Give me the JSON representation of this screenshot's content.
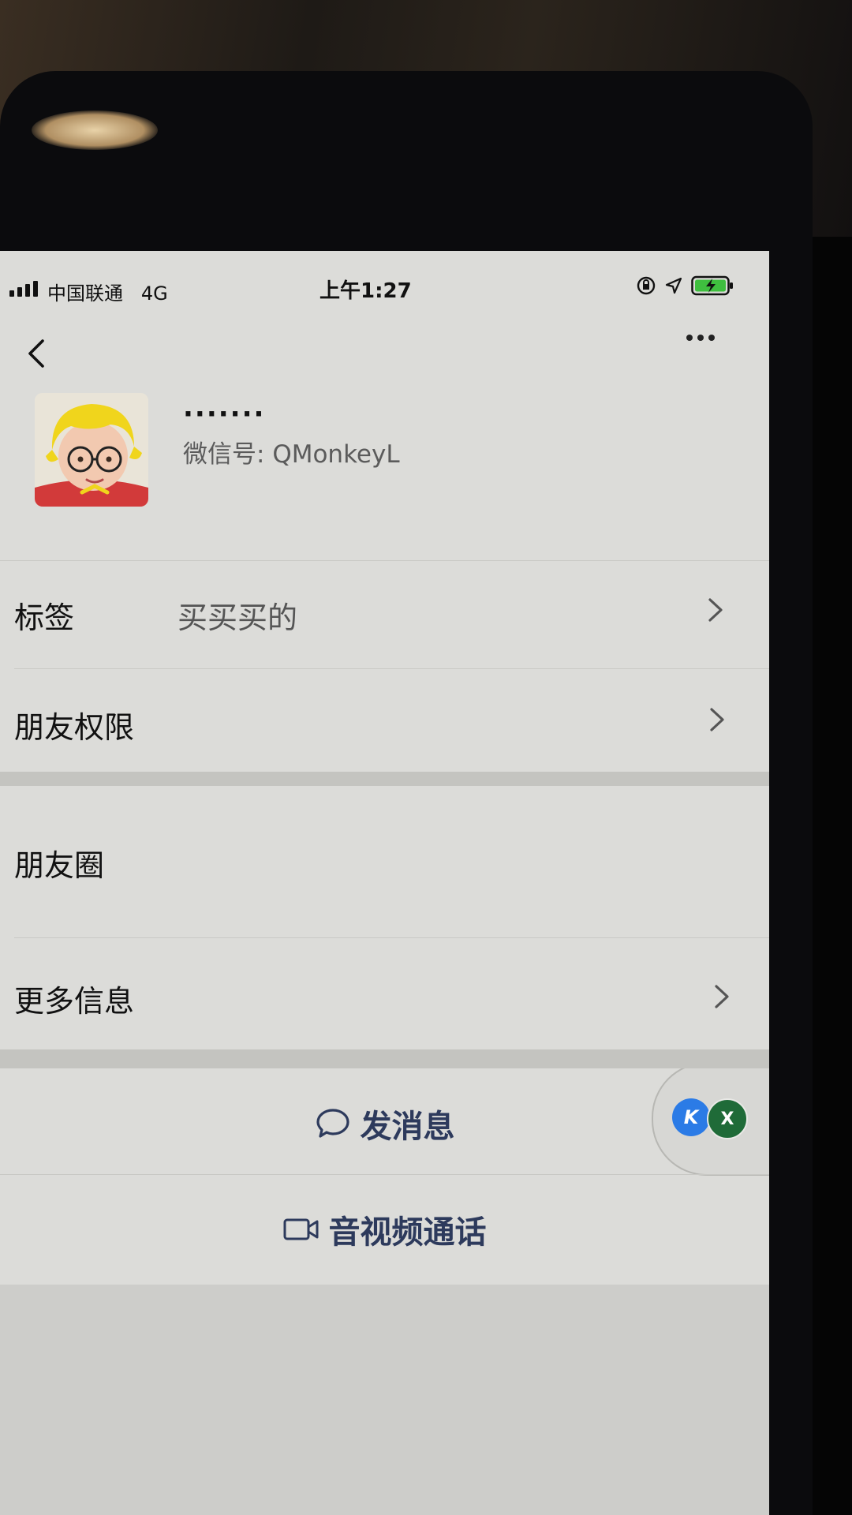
{
  "status_bar": {
    "carrier": "中国联通",
    "network": "4G",
    "time": "上午1:27"
  },
  "profile": {
    "nickname": "·······",
    "wechat_id_label": "微信号:",
    "wechat_id": "QMonkeyL"
  },
  "rows": [
    {
      "label": "标签",
      "value": "买买买的",
      "has_chevron": true
    },
    {
      "label": "朋友权限",
      "value": "",
      "has_chevron": true
    },
    {
      "label": "朋友圈",
      "value": "",
      "badges": [
        "K",
        "X"
      ]
    },
    {
      "label": "更多信息",
      "value": "",
      "has_chevron": true
    }
  ],
  "actions": {
    "send_message": "发消息",
    "av_call": "音视频通话"
  },
  "icons": {
    "back": "chevron-left-icon",
    "more": "more-dots-icon",
    "send_message": "chat-bubble-icon",
    "av_call": "video-camera-icon"
  },
  "colors": {
    "action_text": "#2d3a5c",
    "screen_bg": "#dcdcd9",
    "badge_k": "#2b7be6",
    "badge_x": "#1f6b38"
  }
}
